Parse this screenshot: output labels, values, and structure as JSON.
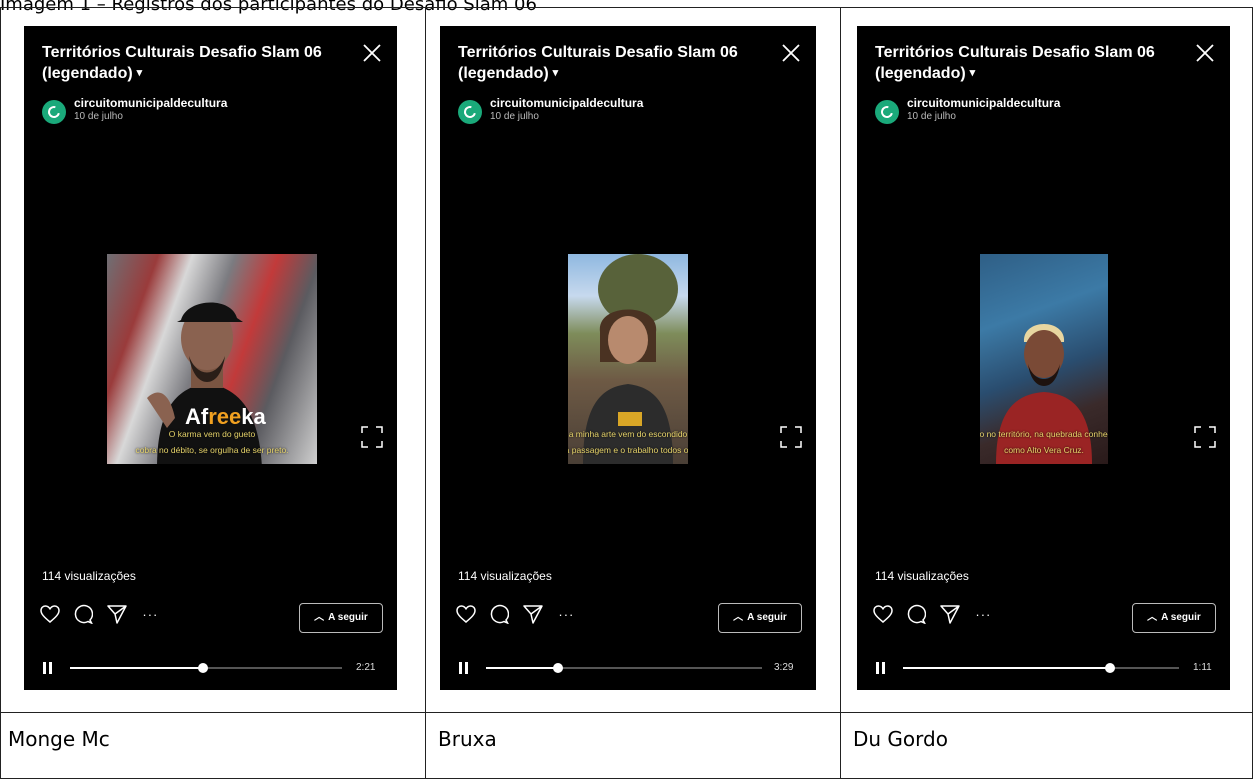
{
  "header": {
    "caption": "Imagem 1 – Registros dos participantes do Desafio Slam 06"
  },
  "columns": [
    {
      "name": "Monge Mc",
      "title": "Territórios Culturais  Desafio Slam 06 (legendado)",
      "account": "circuitomunicipaldecultura",
      "date": "10 de julho",
      "views": "114 visualizações",
      "follow_label": "A seguir",
      "time": "2:21",
      "progress": 0.49,
      "subtitle_lines": [
        "O karma vem do gueto",
        "cobra no débito, se orgulha de ser preto."
      ],
      "shirt_text": "Afreeka"
    },
    {
      "name": "Bruxa",
      "title": "Territórios Culturais  Desafio Slam 06 (legendado)",
      "account": "circuitomunicipaldecultura",
      "date": "10 de julho",
      "views": "114 visualizações",
      "follow_label": "A seguir",
      "time": "3:29",
      "progress": 0.26,
      "subtitle_lines": [
        "a minha arte vem do escondido",
        "entre a passagem e o trabalho todos os dias."
      ]
    },
    {
      "name": "Du Gordo",
      "title": "Territórios Culturais  Desafio Slam 06 (legendado)",
      "account": "circuitomunicipaldecultura",
      "date": "10 de julho",
      "views": "114 visualizações",
      "follow_label": "A seguir",
      "time": "1:11",
      "progress": 0.75,
      "subtitle_lines": [
        "Moro no território, na quebrada conhecida",
        "como Alto Vera Cruz."
      ]
    }
  ],
  "colors": {
    "phone_bg": "#000000",
    "subtitle": "#e6d36a",
    "avatar": "#1aa97a"
  },
  "icons": [
    "close-icon",
    "heart-icon",
    "comment-icon",
    "send-icon",
    "more-icon",
    "chevron-up-icon",
    "pause-icon",
    "fullscreen-icon"
  ]
}
